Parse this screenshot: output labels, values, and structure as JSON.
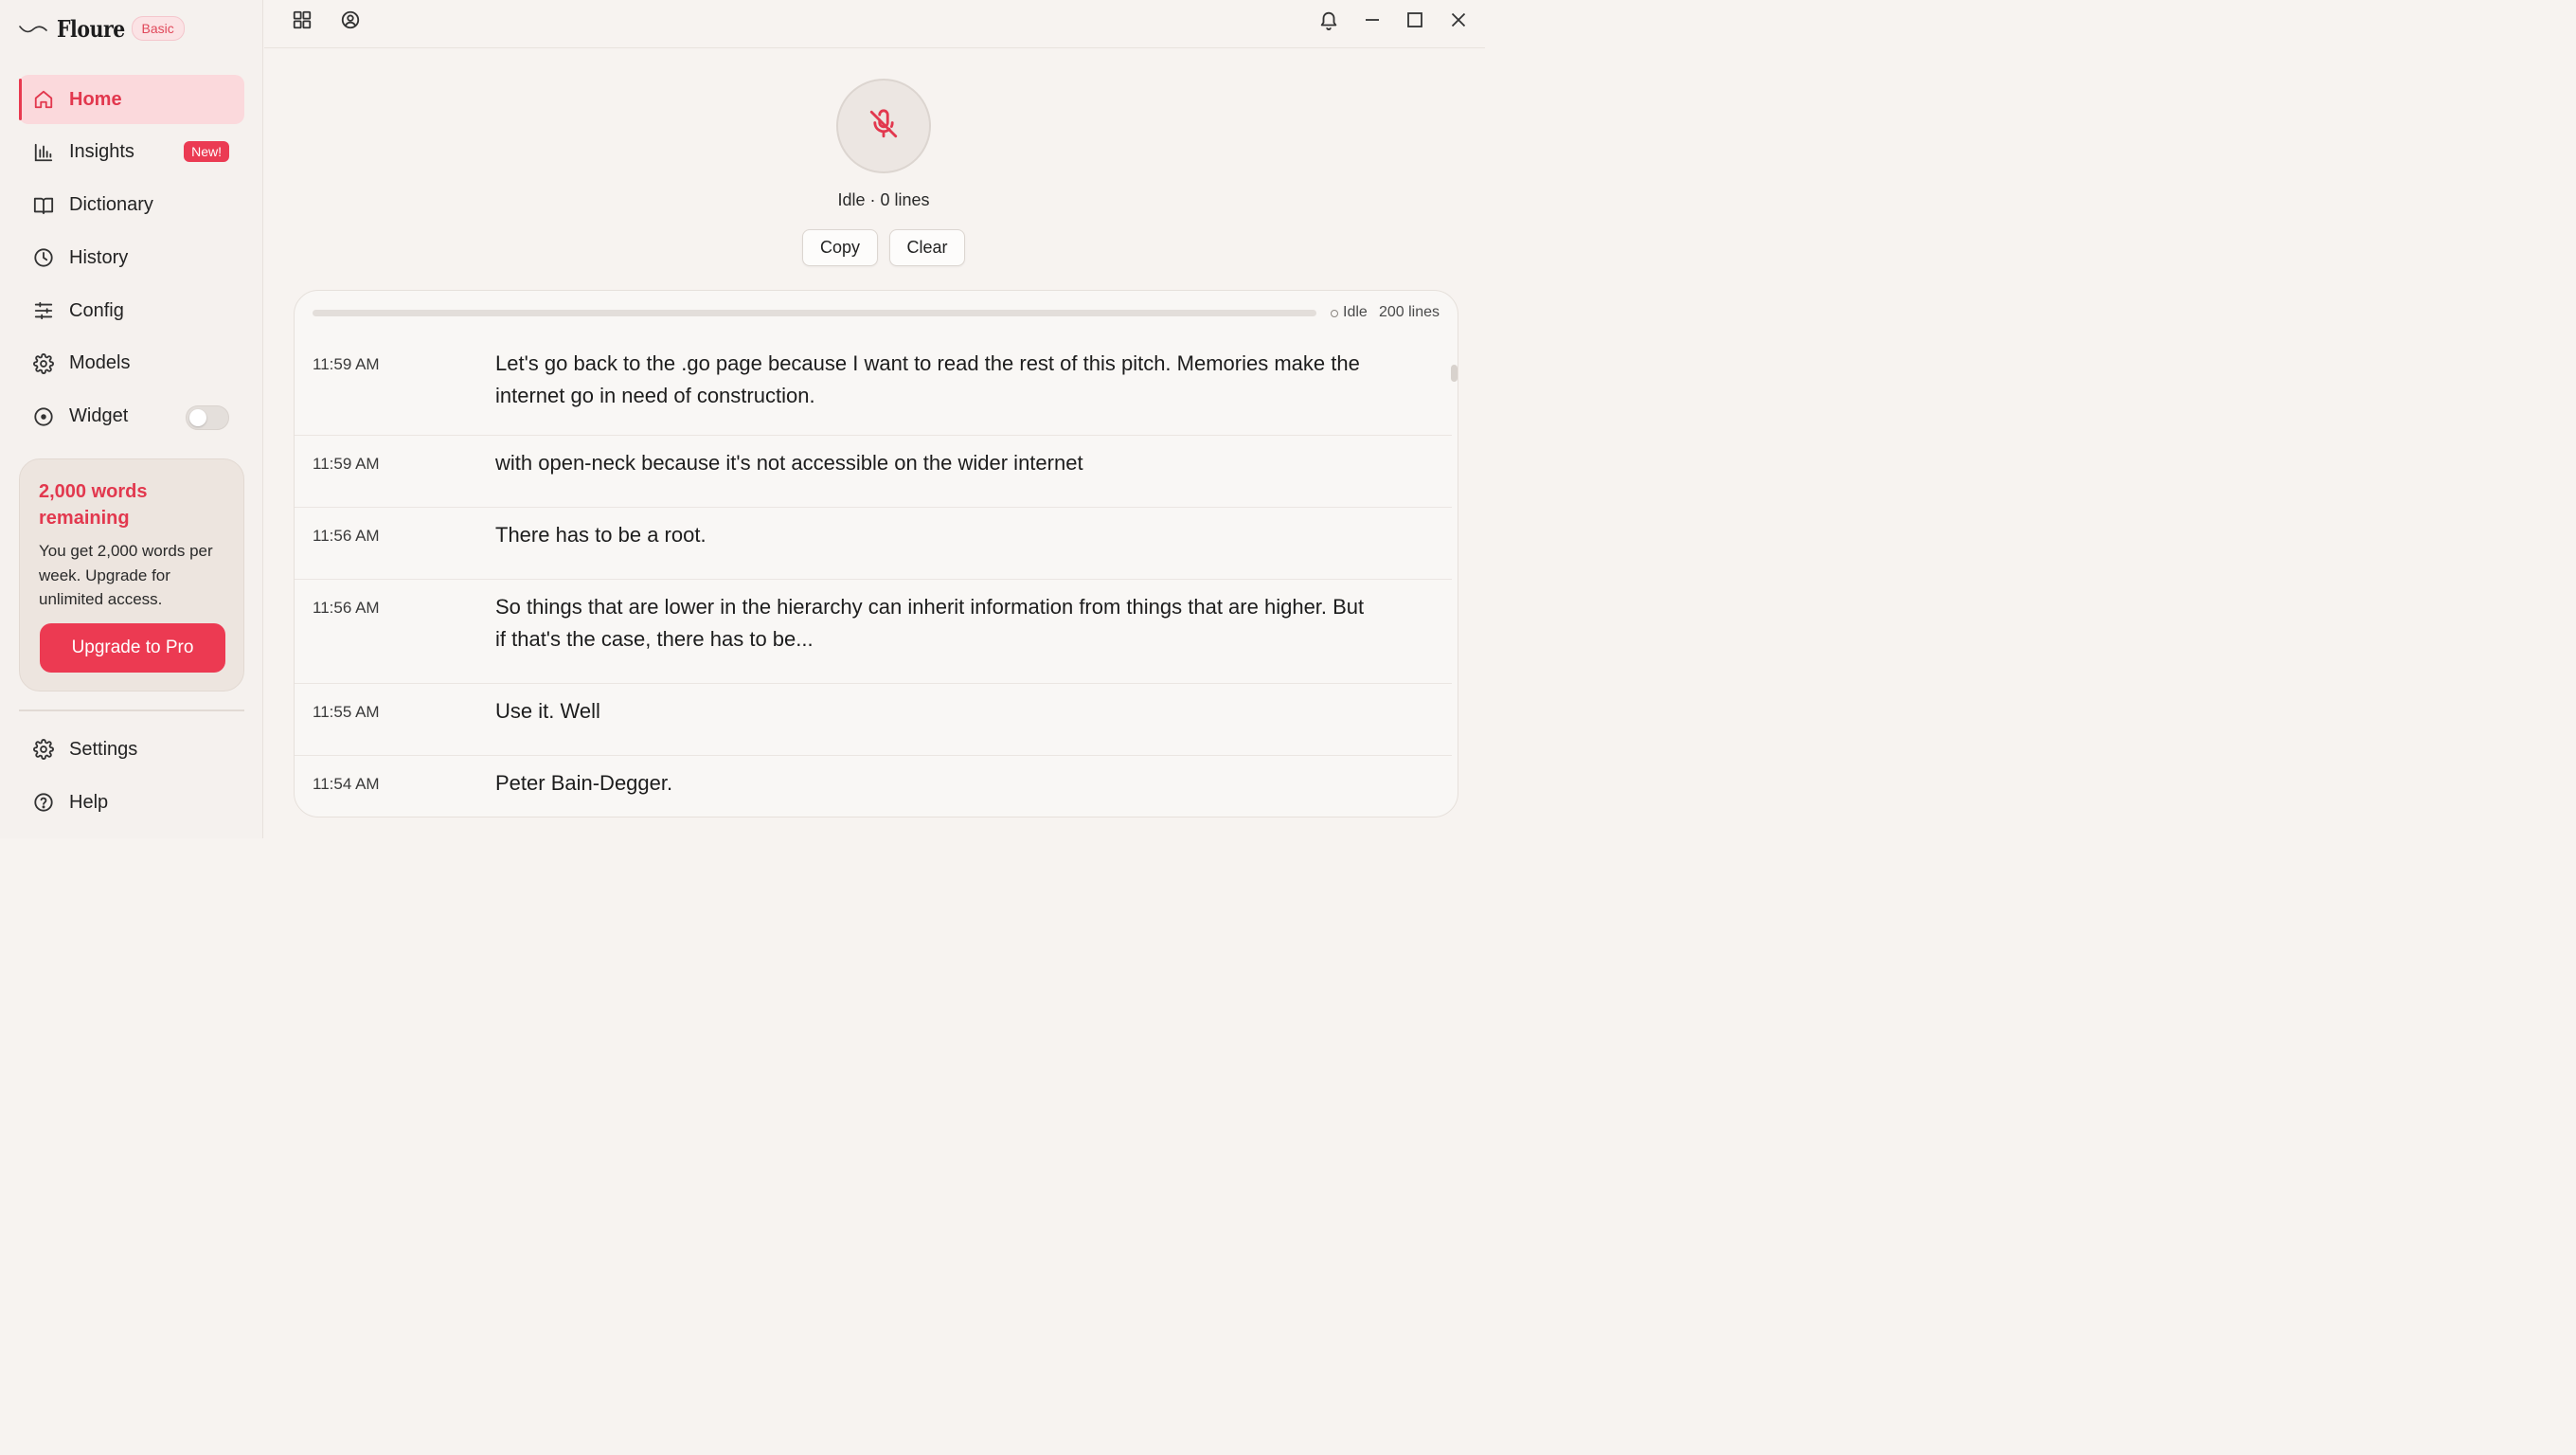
{
  "app": {
    "name": "Floure",
    "plan_badge": "Basic"
  },
  "sidebar": {
    "items": [
      {
        "id": "home",
        "label": "Home",
        "icon": "home-icon",
        "active": true
      },
      {
        "id": "insights",
        "label": "Insights",
        "icon": "bar-chart-icon",
        "badge": "New!"
      },
      {
        "id": "dictionary",
        "label": "Dictionary",
        "icon": "book-icon"
      },
      {
        "id": "history",
        "label": "History",
        "icon": "clock-icon"
      },
      {
        "id": "config",
        "label": "Config",
        "icon": "sliders-icon"
      },
      {
        "id": "models",
        "label": "Models",
        "icon": "gear-icon"
      },
      {
        "id": "widget",
        "label": "Widget",
        "icon": "target-icon",
        "toggle": false
      }
    ],
    "promo": {
      "title": "2,000 words remaining",
      "text": "You get 2,000 words per week. Upgrade for unlimited access.",
      "button": "Upgrade to Pro"
    },
    "bottom_items": [
      {
        "id": "settings",
        "label": "Settings",
        "icon": "gear-icon"
      },
      {
        "id": "help",
        "label": "Help",
        "icon": "help-circle-icon"
      }
    ]
  },
  "topbar": {
    "left_icons": [
      "grid-icon",
      "user-circle-icon"
    ],
    "right_icons": [
      "bell-icon",
      "minimize-icon",
      "maximize-icon",
      "close-icon"
    ]
  },
  "recorder": {
    "mic_icon": "mic-off-icon",
    "status": "Idle · 0 lines",
    "copy_label": "Copy",
    "clear_label": "Clear"
  },
  "transcript": {
    "state": "Idle",
    "line_count": "200 lines",
    "progress": 0,
    "rows": [
      {
        "time": "11:59 AM",
        "text": "Let's go back to the .go page because I want to read the rest of this pitch. Memories make the internet go in need of construction."
      },
      {
        "time": "11:59 AM",
        "text": "with open-neck because it's not accessible on the wider internet"
      },
      {
        "time": "11:56 AM",
        "text": "There has to be a root."
      },
      {
        "time": "11:56 AM",
        "text": "So things that are lower in the hierarchy can inherit information from things that are higher. But if that's the case, there has to be..."
      },
      {
        "time": "11:55 AM",
        "text": "Use it. Well"
      },
      {
        "time": "11:54 AM",
        "text": "Peter Bain-Degger."
      }
    ]
  },
  "colors": {
    "accent": "#e8394f",
    "accent_soft": "#fbd9dc",
    "background": "#f7f3f0",
    "panel": "#f9f7f5"
  }
}
